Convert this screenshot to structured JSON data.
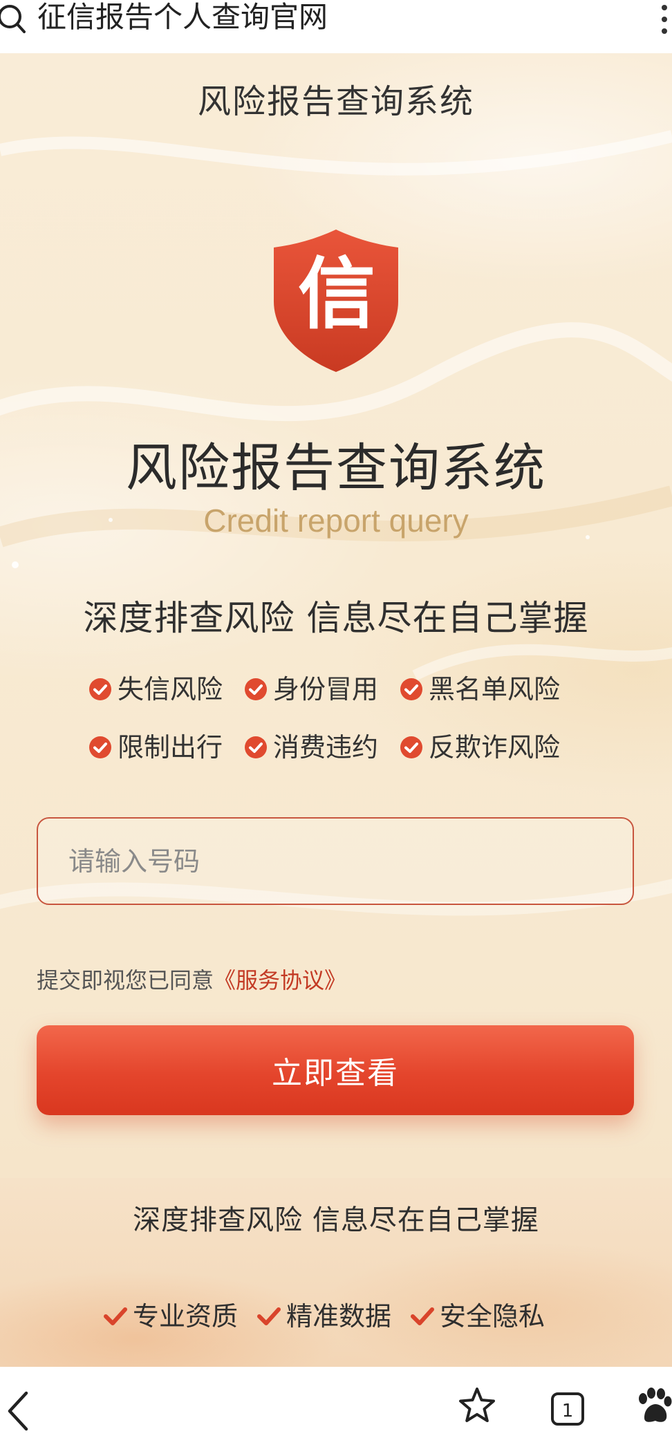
{
  "browser": {
    "search_query": "征信报告个人查询官网",
    "tab_count": "1"
  },
  "page": {
    "header_title": "风险报告查询系统",
    "logo_char": "信",
    "main_title": "风险报告查询系统",
    "subtitle_en": "Credit report query",
    "slogan": "深度排查风险 信息尽在自己掌握",
    "features": [
      "失信风险",
      "身份冒用",
      "黑名单风险",
      "限制出行",
      "消费违约",
      "反欺诈风险"
    ],
    "phone_input": {
      "placeholder": "请输入号码",
      "value": ""
    },
    "agreement": {
      "prefix": "提交即视您已同意",
      "link": "《服务协议》"
    },
    "submit_label": "立即查看",
    "footer_slogan": "深度排查风险 信息尽在自己掌握",
    "badges": [
      "专业资质",
      "精准数据",
      "安全隐私"
    ]
  },
  "colors": {
    "accent_red": "#e4452c",
    "gold_text": "#c8a46b",
    "background": "#f8ead2"
  },
  "icons": {
    "search": "search-icon",
    "more": "more-vertical-icon",
    "logo": "shield-logo-icon",
    "check": "check-circle-icon",
    "tick": "checkmark-icon",
    "back": "chevron-left-icon",
    "star": "star-icon",
    "tabs": "tabs-icon",
    "paw": "paw-icon"
  }
}
